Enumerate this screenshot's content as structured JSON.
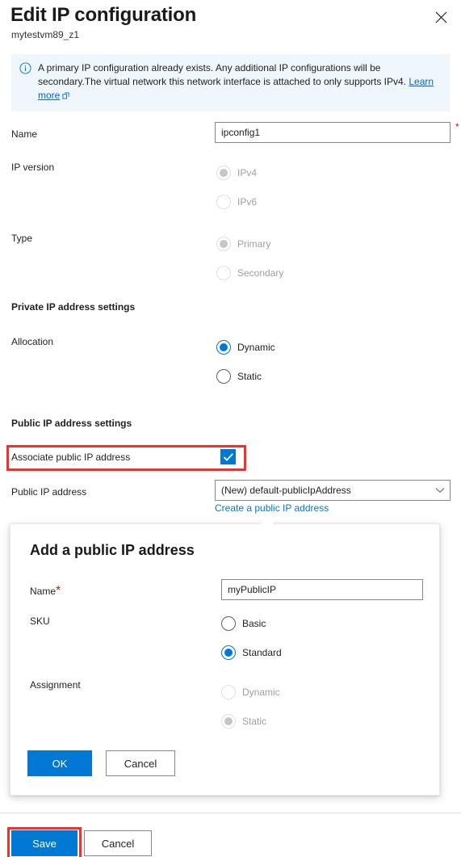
{
  "header": {
    "title": "Edit IP configuration",
    "subtitle": "mytestvm89_z1",
    "close_icon": "close-icon"
  },
  "banner": {
    "icon": "info-icon",
    "text": "A primary IP configuration already exists. Any additional IP configurations will be secondary.The virtual network this network interface is attached to only supports IPv4.",
    "link_label": "Learn more",
    "external_icon": "external-link-icon"
  },
  "form": {
    "name": {
      "label": "Name",
      "value": "ipconfig1",
      "placeholder": "",
      "required_marker": "*"
    },
    "ip_version": {
      "label": "IP version",
      "options": [
        {
          "label": "IPv4",
          "checked": true,
          "disabled": true
        },
        {
          "label": "IPv6",
          "checked": false,
          "disabled": true
        }
      ]
    },
    "type": {
      "label": "Type",
      "options": [
        {
          "label": "Primary",
          "checked": true,
          "disabled": true
        },
        {
          "label": "Secondary",
          "checked": false,
          "disabled": true
        }
      ]
    },
    "private_section": "Private IP address settings",
    "allocation": {
      "label": "Allocation",
      "options": [
        {
          "label": "Dynamic",
          "checked": true,
          "disabled": false
        },
        {
          "label": "Static",
          "checked": false,
          "disabled": false
        }
      ]
    },
    "public_section": "Public IP address settings",
    "associate": {
      "label": "Associate public IP address",
      "checked": true,
      "check_icon": "checkmark-icon"
    },
    "public_ip": {
      "label": "Public IP address",
      "value": "(New) default-publicIpAddress",
      "chevron_icon": "chevron-down-icon",
      "create_link": "Create a public IP address"
    }
  },
  "callout": {
    "title": "Add a public IP address",
    "name": {
      "label": "Name",
      "required_marker": "*",
      "value": "myPublicIP",
      "placeholder": ""
    },
    "sku": {
      "label": "SKU",
      "options": [
        {
          "label": "Basic",
          "checked": false,
          "disabled": false
        },
        {
          "label": "Standard",
          "checked": true,
          "disabled": false
        }
      ]
    },
    "assignment": {
      "label": "Assignment",
      "options": [
        {
          "label": "Dynamic",
          "checked": false,
          "disabled": true
        },
        {
          "label": "Static",
          "checked": true,
          "disabled": true
        }
      ]
    },
    "ok_label": "OK",
    "cancel_label": "Cancel"
  },
  "footer": {
    "save_label": "Save",
    "cancel_label": "Cancel"
  },
  "colors": {
    "accent": "#0078d4",
    "banner_bg": "#eff6fc",
    "required": "#a4262c",
    "annotation": "#f0322d",
    "link": "#0078d4"
  }
}
